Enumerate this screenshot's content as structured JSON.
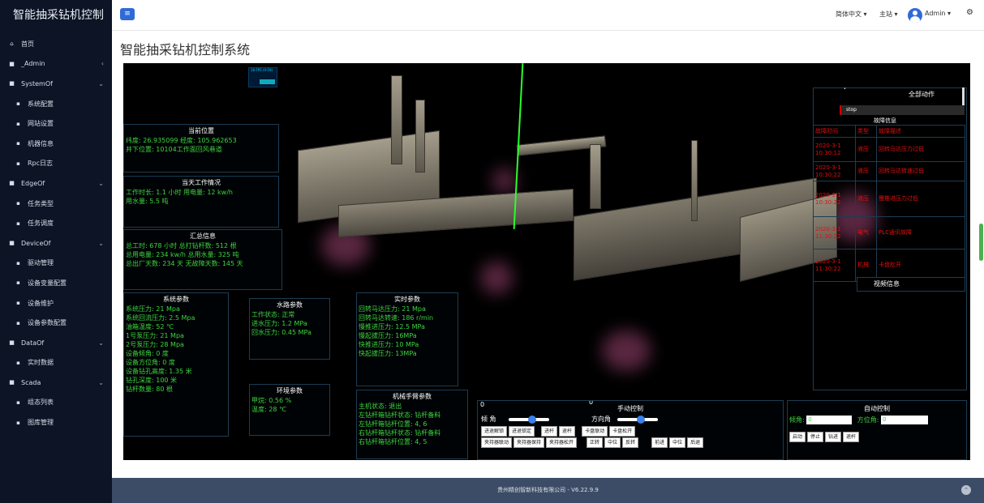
{
  "sidebar": {
    "brand": "智能抽采钻机控制",
    "items": [
      {
        "label": "首页",
        "level": 1,
        "icon": "home-icon",
        "caret": ""
      },
      {
        "label": "_Admin",
        "level": 1,
        "icon": "folder-icon",
        "caret": "‹"
      },
      {
        "label": "SystemOf",
        "level": 1,
        "icon": "folder-icon",
        "caret": "⌄"
      },
      {
        "label": "系统配置",
        "level": 2,
        "icon": "file-icon",
        "caret": ""
      },
      {
        "label": "网站设置",
        "level": 2,
        "icon": "file-icon",
        "caret": ""
      },
      {
        "label": "机器信息",
        "level": 2,
        "icon": "file-icon",
        "caret": ""
      },
      {
        "label": "Rpc日志",
        "level": 2,
        "icon": "file-icon",
        "caret": ""
      },
      {
        "label": "EdgeOf",
        "level": 1,
        "icon": "folder-icon",
        "caret": "⌄"
      },
      {
        "label": "任务类型",
        "level": 2,
        "icon": "file-icon",
        "caret": ""
      },
      {
        "label": "任务调度",
        "level": 2,
        "icon": "file-icon",
        "caret": ""
      },
      {
        "label": "DeviceOf",
        "level": 1,
        "icon": "folder-icon",
        "caret": "⌄"
      },
      {
        "label": "驱动管理",
        "level": 2,
        "icon": "file-icon",
        "caret": ""
      },
      {
        "label": "设备变量配置",
        "level": 2,
        "icon": "file-icon",
        "caret": ""
      },
      {
        "label": "设备维护",
        "level": 2,
        "icon": "file-icon",
        "caret": ""
      },
      {
        "label": "设备参数配置",
        "level": 2,
        "icon": "file-icon",
        "caret": ""
      },
      {
        "label": "DataOf",
        "level": 1,
        "icon": "folder-icon",
        "caret": "⌄"
      },
      {
        "label": "实时数据",
        "level": 2,
        "icon": "file-icon",
        "caret": ""
      },
      {
        "label": "Scada",
        "level": 1,
        "icon": "folder-icon",
        "caret": "⌄"
      },
      {
        "label": "组态列表",
        "level": 2,
        "icon": "file-icon",
        "caret": ""
      },
      {
        "label": "图库管理",
        "level": 2,
        "icon": "file-icon",
        "caret": ""
      }
    ]
  },
  "header": {
    "menu_icon": "≡",
    "language": "简体中文 ▾",
    "site": "主站 ▾",
    "user": "Admin ▾",
    "settings_icon": "⚙"
  },
  "page_title": "智能抽采钻机控制系统",
  "fps": "18 FPS (0-59)",
  "position": {
    "title": "当前位置",
    "lat_label": "纬度:",
    "lat": "26.935099",
    "lng_label": "经度:",
    "lng": "105.962653",
    "loc_label": "井下位置:",
    "loc": "10104工作面回风巷道"
  },
  "today": {
    "title": "当天工作情况",
    "hours_label": "工作时长:",
    "hours": "1.1 小时",
    "power_label": "用电量:",
    "power": "12 kw/h",
    "water_label": "用水量:",
    "water": "5.5 吨"
  },
  "summary": {
    "title": "汇总信息",
    "l1": "总工时: 678 小时 总打钻杆数: 512 根",
    "l2": "总用电量: 234 kw/h 总用水量: 325 吨",
    "l3": "总出厂天数: 234 天 无故障天数: 145 天"
  },
  "sys_params": {
    "title": "系统参数",
    "rows": [
      "系统压力: 21 Mpa",
      "系统回流压力: 2.5 Mpa",
      "油箱温度: 52 ℃",
      "1号泵压力: 21 Mpa",
      "2号泵压力: 28 Mpa",
      "设备倾角: 0 度",
      "设备方位角: 0 度",
      "设备钻孔高度: 1.35 米",
      "钻孔深度: 100 米",
      "钻杆数量: 80 根"
    ]
  },
  "water_params": {
    "title": "水路参数",
    "rows": [
      "工作状态: 正常",
      "进水压力: 1.2 MPa",
      "回水压力: 0.45 MPa"
    ]
  },
  "env_params": {
    "title": "环境参数",
    "rows": [
      "甲烷: 0.56 %",
      "温度: 28 ℃"
    ]
  },
  "realtime_params": {
    "title": "实时参数",
    "rows": [
      "回转马达压力: 21 Mpa",
      "回转马达转速: 186 r/min",
      "慢推进压力: 12.5 MPa",
      "慢起拔压力: 16MPa",
      "快推进压力: 10 MPa",
      "快起拔压力: 13MPa"
    ]
  },
  "arm": {
    "title": "机械手臂参数",
    "rows": [
      "主机状态: 退出",
      "左钻杆箱钻杆状态: 钻杆备料",
      "左钻杆箱钻杆位置: 4, 6",
      "右钻杆箱钻杆状态: 钻杆备料",
      "右钻杆箱钻杆位置: 4, 5"
    ]
  },
  "manual": {
    "title": "手动控制",
    "val1": "0",
    "val2": "0",
    "tilt_label": "倾 角",
    "azimuth_label": "方向角",
    "row1": [
      "进退解锁",
      "进退锁定",
      "进杆",
      "退杆",
      "卡盘联动",
      "卡盘松开"
    ],
    "row2": [
      "夹持器联动",
      "夹持器保持",
      "夹持器松开",
      "正转",
      "中位",
      "反转",
      "前进",
      "中位",
      "后退"
    ]
  },
  "auto": {
    "title": "自动控制",
    "tilt_label": "倾角:",
    "tilt": "0",
    "az_label": "方位角:",
    "az": "0",
    "buttons": [
      "启动",
      "停止",
      "钻进",
      "退杆"
    ]
  },
  "right_panel": {
    "all_actions": "全部动作",
    "stop": "stop",
    "fault_title": "故障信息",
    "headers": [
      "故障时间",
      "类型",
      "故障描述"
    ],
    "rows": [
      {
        "time": "2020-3-1 10:30:12",
        "type": "液压",
        "desc": "回转马达压力过低"
      },
      {
        "time": "2020-3-1 10:30:22",
        "type": "液压",
        "desc": "回转马达转速过低"
      },
      {
        "time": "2020-3-1 10:30:22",
        "type": "液压",
        "desc": "慢推进压力过低"
      },
      {
        "time": "2020-3-1 11:30:22",
        "type": "电气",
        "desc": "PLC通讯故障"
      },
      {
        "time": "2020-3-1 11:30:22",
        "type": "机械",
        "desc": "卡盘松开"
      }
    ],
    "video_title": "视频信息"
  },
  "footer": {
    "text": "贵州精创智新科技有限公司 - V6.22.9.9",
    "icon": "⌃"
  }
}
